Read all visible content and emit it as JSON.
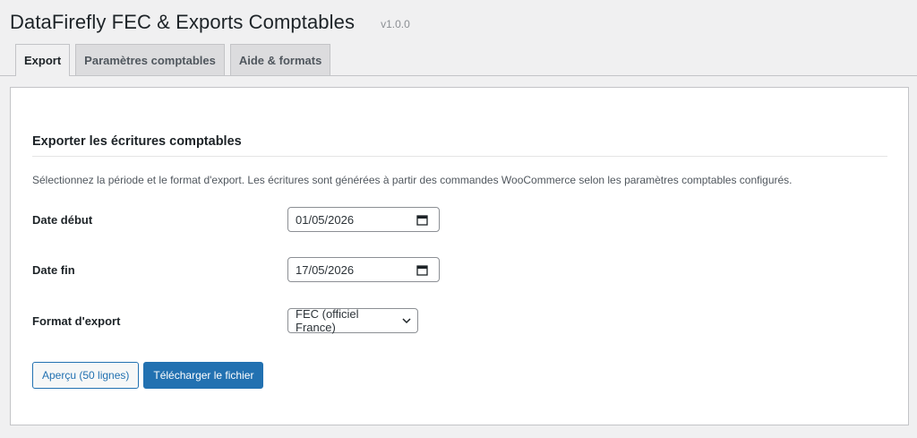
{
  "header": {
    "title": "DataFirefly FEC & Exports Comptables",
    "version": "v1.0.0"
  },
  "tabs": [
    {
      "label": "Export",
      "active": true
    },
    {
      "label": "Paramètres comptables",
      "active": false
    },
    {
      "label": "Aide & formats",
      "active": false
    }
  ],
  "export_section": {
    "title": "Exporter les écritures comptables",
    "description": "Sélectionnez la période et le format d'export. Les écritures sont générées à partir des commandes WooCommerce selon les paramètres comptables configurés.",
    "start_date": {
      "label": "Date début",
      "value": "01/05/2026",
      "icon": "calendar-icon"
    },
    "end_date": {
      "label": "Date fin",
      "value": "17/05/2026",
      "icon": "calendar-icon"
    },
    "format": {
      "label": "Format d'export",
      "value": "FEC (officiel France)",
      "icon": "chevron-down-icon"
    },
    "buttons": {
      "preview": "Aperçu (50 lignes)",
      "download": "Télécharger le fichier"
    }
  },
  "colors": {
    "accent": "#2271b1",
    "background": "#f0f0f1",
    "card": "#ffffff",
    "border": "#c3c4c7"
  }
}
